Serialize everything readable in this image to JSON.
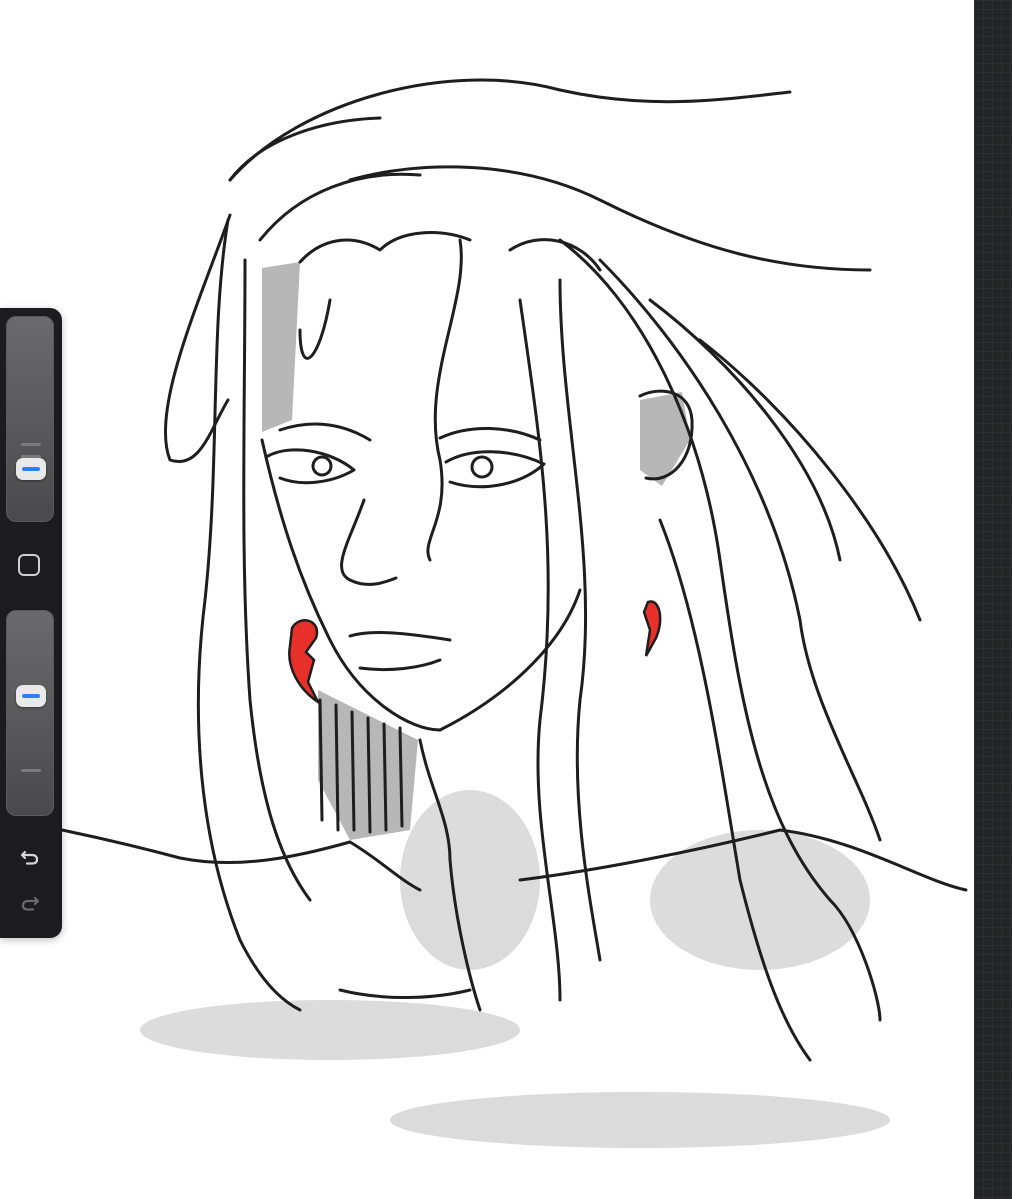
{
  "app": "drawing-canvas",
  "icons": {
    "modify": "square-icon",
    "undo": "undo-icon",
    "redo": "redo-icon"
  },
  "colors": {
    "accent": "#2f7cf6",
    "earring": "#e8302a",
    "sidebar": "#1c1c1e"
  },
  "toolbar": {
    "brush_size_level": 0.2,
    "opacity_level": 0.6
  }
}
